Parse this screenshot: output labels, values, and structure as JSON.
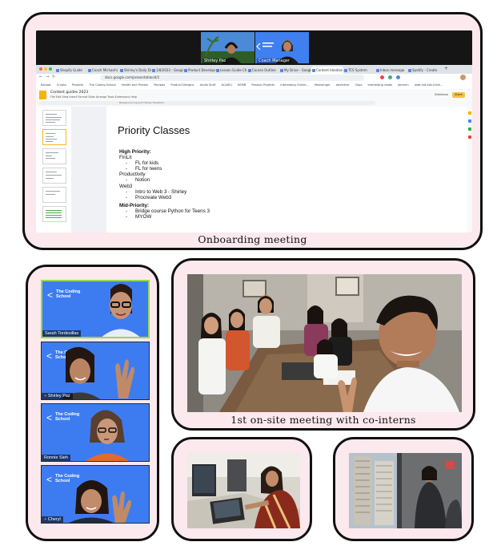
{
  "captions": {
    "onboarding": "Onboarding meeting",
    "onsite": "1st on-site meeting with co-interns"
  },
  "video_call": {
    "participants": [
      "Shirley Paz",
      "Coach Manager"
    ]
  },
  "browser": {
    "tabs": [
      "Shopify Guide",
      "Coach Michael's",
      "Shirley's Daily Dr...",
      "1/8/2023 - Google",
      "Product Developm...",
      "Lesson Guide Ch...",
      "Course Outline",
      "My Drive - Google",
      "Content Ideation",
      "TCS System",
      "Inbox message",
      "Spotify - Create"
    ],
    "url": "docs.google.com/presentation/d/1",
    "bookmarks": [
      "Kahoot",
      "Crypto",
      "Projects",
      "The Coding School",
      "Health and Fitness",
      "Recipes",
      "Product Designs",
      "Audio Stuff",
      "ACAIEU",
      "KEMB",
      "Passion Projects",
      "Interesting Online...",
      "Messenger",
      "advertise",
      "Clips",
      "Interesting reads",
      "Jammin",
      "web.md edu.blink..."
    ]
  },
  "slides_app": {
    "doc_title": "Content guides 2023",
    "menu": "File  Edit  View  Insert  Format  Slide  Arrange  Tools  Extensions  Help",
    "toolbar": "Background  Layout  Theme  Transition",
    "slideshow_label": "Slideshow",
    "share_label": "Share",
    "slide": {
      "title": "Priority Classes",
      "lines": [
        {
          "text": "High Priority:",
          "style": "h"
        },
        {
          "text": "FinLit",
          "style": "l0"
        },
        {
          "text": "FL for kids",
          "style": "l1"
        },
        {
          "text": "FL for teens",
          "style": "l1"
        },
        {
          "text": "Productivity",
          "style": "l0"
        },
        {
          "text": "Notion",
          "style": "l1"
        },
        {
          "text": "Web3",
          "style": "l0"
        },
        {
          "text": "Intro to Web 3 - Shirley",
          "style": "l1"
        },
        {
          "text": "Procreate Web3",
          "style": "l1"
        },
        {
          "text": "",
          "style": "gap"
        },
        {
          "text": "Mid-Priority:",
          "style": "h"
        },
        {
          "text": "Bridge course Python for Teens 3",
          "style": "l1"
        },
        {
          "text": "MYOW",
          "style": "l1"
        }
      ]
    }
  },
  "grid_call": {
    "logo_text": "The Coding School",
    "participants": [
      "Sarah Tordesillas",
      "Shirley Paz",
      "Ronnie Sieh",
      "Cheryl"
    ]
  },
  "colors": {
    "frame_bg": "#fbe9ee",
    "tile_blue": "#3d7cf0",
    "active_speaker": "#9bd84a",
    "share_button": "#f6c344"
  }
}
